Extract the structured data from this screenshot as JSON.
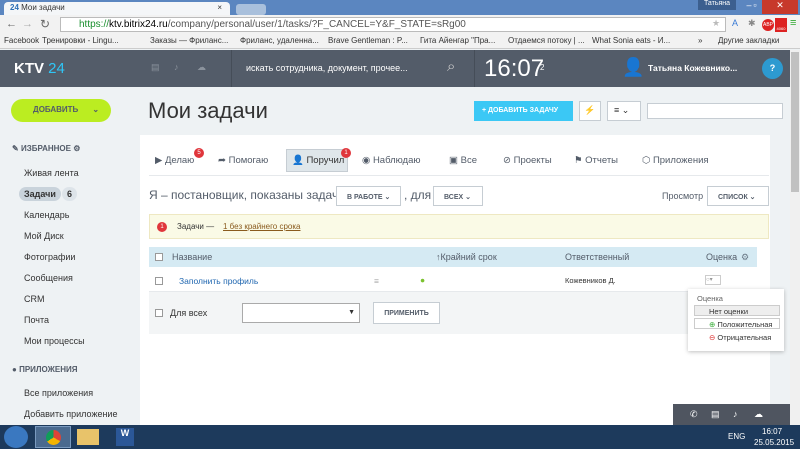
{
  "browser": {
    "tab_title": "Мои задачи",
    "tab_close": "×",
    "user": "Татьяна",
    "url_secure": "https://",
    "url_host": "ktv.bitrix24.ru",
    "url_path": "/company/personal/user/1/tasks/?F_CANCEL=Y&F_STATE=sRg00",
    "bookmarks": [
      "Facebook",
      "Тренировки - Lingu...",
      "Заказы — Фриланс...",
      "Фриланс, удаленна...",
      "Brave Gentleman : P...",
      "Гита Айенгар \"Пра...",
      "Отдаемся потоку | ...",
      "What Sonia eats - И..."
    ],
    "other_bookmarks": "Другие закладки",
    "more": "»",
    "abp_count": "4060"
  },
  "header": {
    "logo_text": "KTV",
    "logo_num": "24",
    "search_placeholder": "искать сотрудника, документ, прочее...",
    "clock": "16:07",
    "flag_count": "2",
    "user_name": "Татьяна Кожевнико...",
    "help": "?"
  },
  "sidebar": {
    "add_label": "ДОБАВИТЬ",
    "favorites": "ИЗБРАННОЕ",
    "items": [
      "Живая лента",
      "Задачи",
      "Календарь",
      "Мой Диск",
      "Фотографии",
      "Сообщения",
      "CRM",
      "Почта",
      "Мои процессы"
    ],
    "tasks_count": "6",
    "apps_head": "ПРИЛОЖЕНИЯ",
    "apps": [
      "Все приложения",
      "Добавить приложение"
    ]
  },
  "page": {
    "title": "Мои задачи",
    "add_task": "ДОБАВИТЬ ЗАДАЧУ"
  },
  "tabs": [
    {
      "label": "Делаю",
      "badge": "5"
    },
    {
      "label": "Помогаю"
    },
    {
      "label": "Поручил",
      "badge": "1"
    },
    {
      "label": "Наблюдаю"
    },
    {
      "label": "Все"
    },
    {
      "label": "Проекты"
    },
    {
      "label": "Отчеты"
    },
    {
      "label": "Приложения"
    }
  ],
  "filter": {
    "text": "Я – постановщик, показаны задачи",
    "status": "В РАБОТЕ",
    "for": ", для",
    "who": "ВСЕХ",
    "view_label": "Просмотр",
    "view": "СПИСОК"
  },
  "notice": {
    "count": "1",
    "text": "Задачи —",
    "link": "1 без крайнего срока"
  },
  "table": {
    "columns": [
      "Название",
      "↑Крайний срок",
      "Ответственный",
      "Оценка"
    ],
    "rows": [
      {
        "name": "Заполнить профиль",
        "responsible": "Кожевников Д."
      }
    ]
  },
  "footer": {
    "for_all": "Для всех",
    "apply": "ПРИМЕНИТЬ"
  },
  "rating_popup": {
    "title": "Оценка",
    "options": [
      "Нет оценки",
      "Положительная",
      "Отрицательная"
    ]
  },
  "taskbar": {
    "lang": "ENG",
    "time": "16:07",
    "date": "25.05.2015"
  }
}
